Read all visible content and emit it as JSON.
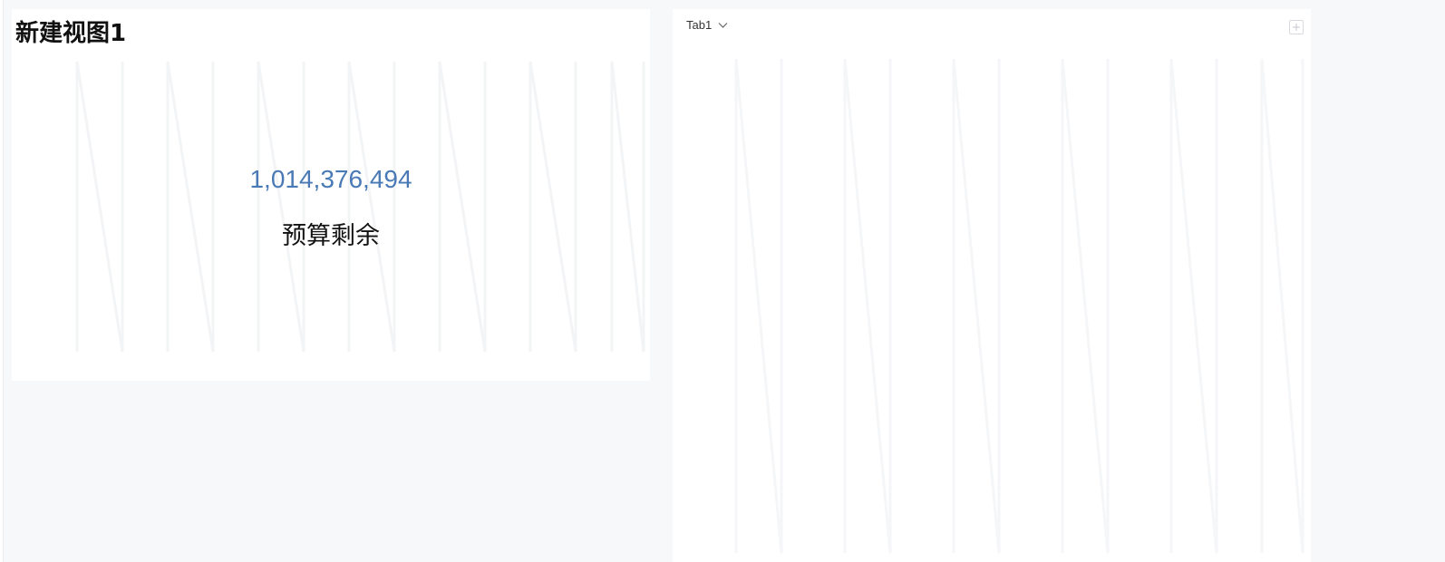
{
  "view": {
    "title": "新建视图1"
  },
  "kpi": {
    "value": "1,014,376,494",
    "label": "预算剩余",
    "value_color": "#4a7ab5"
  },
  "tabs": {
    "items": [
      {
        "label": "Tab1"
      }
    ],
    "dropdown_icon": "chevron-down-icon",
    "add_icon": "plus-icon"
  }
}
